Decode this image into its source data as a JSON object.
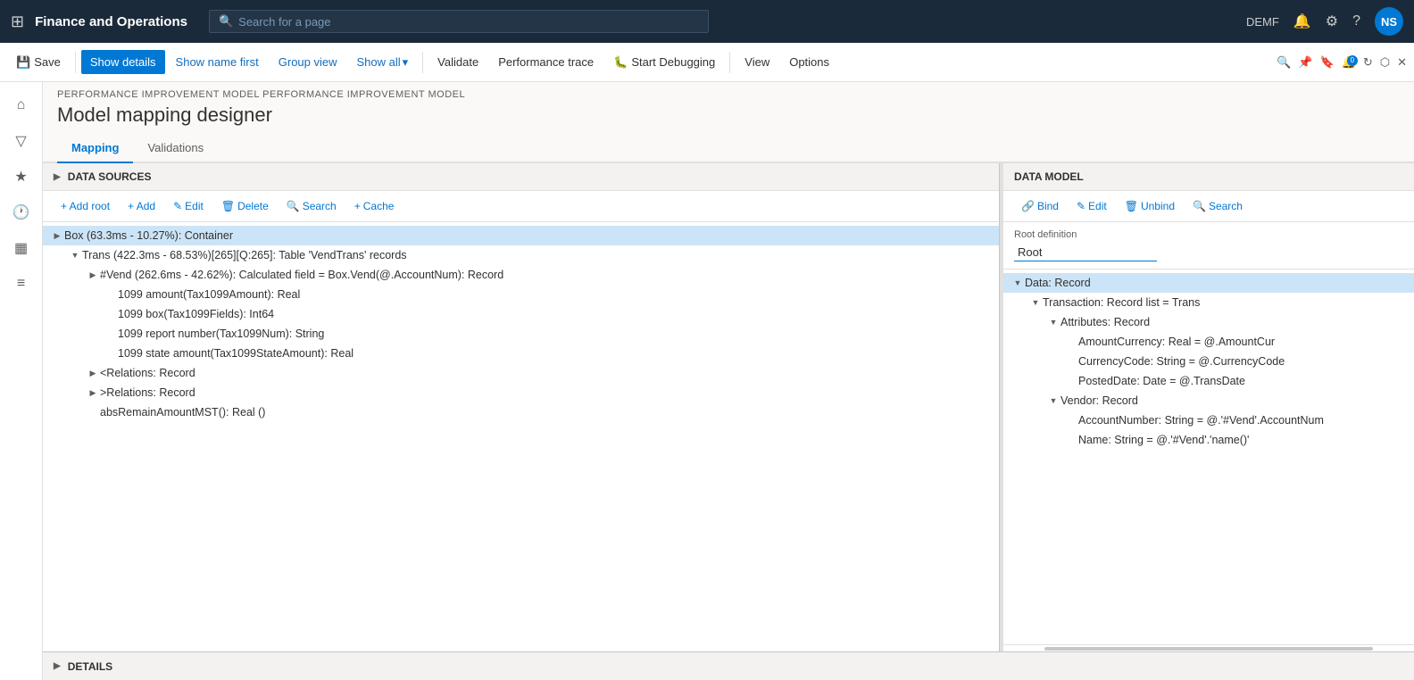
{
  "app": {
    "title": "Finance and Operations",
    "search_placeholder": "Search for a page",
    "env": "DEMF",
    "user_initials": "NS"
  },
  "command_bar": {
    "save_label": "Save",
    "show_details_label": "Show details",
    "show_name_label": "Show name first",
    "group_view_label": "Group view",
    "show_all_label": "Show all",
    "validate_label": "Validate",
    "performance_trace_label": "Performance trace",
    "start_debugging_label": "Start Debugging",
    "view_label": "View",
    "options_label": "Options"
  },
  "page": {
    "breadcrumb": "PERFORMANCE IMPROVEMENT MODEL PERFORMANCE IMPROVEMENT MODEL",
    "title": "Model mapping designer"
  },
  "tabs": {
    "mapping": "Mapping",
    "validations": "Validations"
  },
  "data_sources_panel": {
    "header": "DATA SOURCES",
    "toolbar": {
      "add_root": "+ Add root",
      "add": "+ Add",
      "edit": "Edit",
      "delete": "Delete",
      "search": "Search",
      "cache": "Cache"
    },
    "tree": [
      {
        "id": 1,
        "level": 0,
        "indent": 0,
        "expanded": true,
        "selected": true,
        "label": "Box (63.3ms - 10.27%): Container"
      },
      {
        "id": 2,
        "level": 1,
        "indent": 1,
        "expanded": true,
        "selected": false,
        "label": "Trans (422.3ms - 68.53%)[265][Q:265]: Table 'VendTrans' records"
      },
      {
        "id": 3,
        "level": 2,
        "indent": 2,
        "expanded": false,
        "selected": false,
        "label": "#Vend (262.6ms - 42.62%): Calculated field = Box.Vend(@.AccountNum): Record"
      },
      {
        "id": 4,
        "level": 3,
        "indent": 3,
        "expanded": false,
        "selected": false,
        "label": "1099 amount(Tax1099Amount): Real"
      },
      {
        "id": 5,
        "level": 3,
        "indent": 3,
        "expanded": false,
        "selected": false,
        "label": "1099 box(Tax1099Fields): Int64"
      },
      {
        "id": 6,
        "level": 3,
        "indent": 3,
        "expanded": false,
        "selected": false,
        "label": "1099 report number(Tax1099Num): String"
      },
      {
        "id": 7,
        "level": 3,
        "indent": 3,
        "expanded": false,
        "selected": false,
        "label": "1099 state amount(Tax1099StateAmount): Real"
      },
      {
        "id": 8,
        "level": 2,
        "indent": 2,
        "expanded": false,
        "selected": false,
        "label": "<Relations: Record"
      },
      {
        "id": 9,
        "level": 2,
        "indent": 2,
        "expanded": false,
        "selected": false,
        "label": ">Relations: Record"
      },
      {
        "id": 10,
        "level": 2,
        "indent": 2,
        "expanded": false,
        "selected": false,
        "label": "absRemainAmountMST(): Real ()"
      }
    ]
  },
  "data_model_panel": {
    "header": "DATA MODEL",
    "toolbar": {
      "bind": "Bind",
      "edit": "Edit",
      "unbind": "Unbind",
      "search": "Search"
    },
    "root_definition_label": "Root definition",
    "root_value": "Root",
    "tree": [
      {
        "id": 1,
        "level": 0,
        "indent": 0,
        "expanded": true,
        "selected": true,
        "label": "Data: Record"
      },
      {
        "id": 2,
        "level": 1,
        "indent": 1,
        "expanded": true,
        "selected": false,
        "label": "Transaction: Record list = Trans"
      },
      {
        "id": 3,
        "level": 2,
        "indent": 2,
        "expanded": true,
        "selected": false,
        "label": "Attributes: Record"
      },
      {
        "id": 4,
        "level": 3,
        "indent": 3,
        "expanded": false,
        "selected": false,
        "label": "AmountCurrency: Real = @.AmountCur"
      },
      {
        "id": 5,
        "level": 3,
        "indent": 3,
        "expanded": false,
        "selected": false,
        "label": "CurrencyCode: String = @.CurrencyCode"
      },
      {
        "id": 6,
        "level": 3,
        "indent": 3,
        "expanded": false,
        "selected": false,
        "label": "PostedDate: Date = @.TransDate"
      },
      {
        "id": 7,
        "level": 2,
        "indent": 2,
        "expanded": true,
        "selected": false,
        "label": "Vendor: Record"
      },
      {
        "id": 8,
        "level": 3,
        "indent": 3,
        "expanded": false,
        "selected": false,
        "label": "AccountNumber: String = @.'#Vend'.AccountNum"
      },
      {
        "id": 9,
        "level": 3,
        "indent": 3,
        "expanded": false,
        "selected": false,
        "label": "Name: String = @.'#Vend'.'name()'"
      }
    ]
  },
  "details_panel": {
    "header": "DETAILS"
  }
}
